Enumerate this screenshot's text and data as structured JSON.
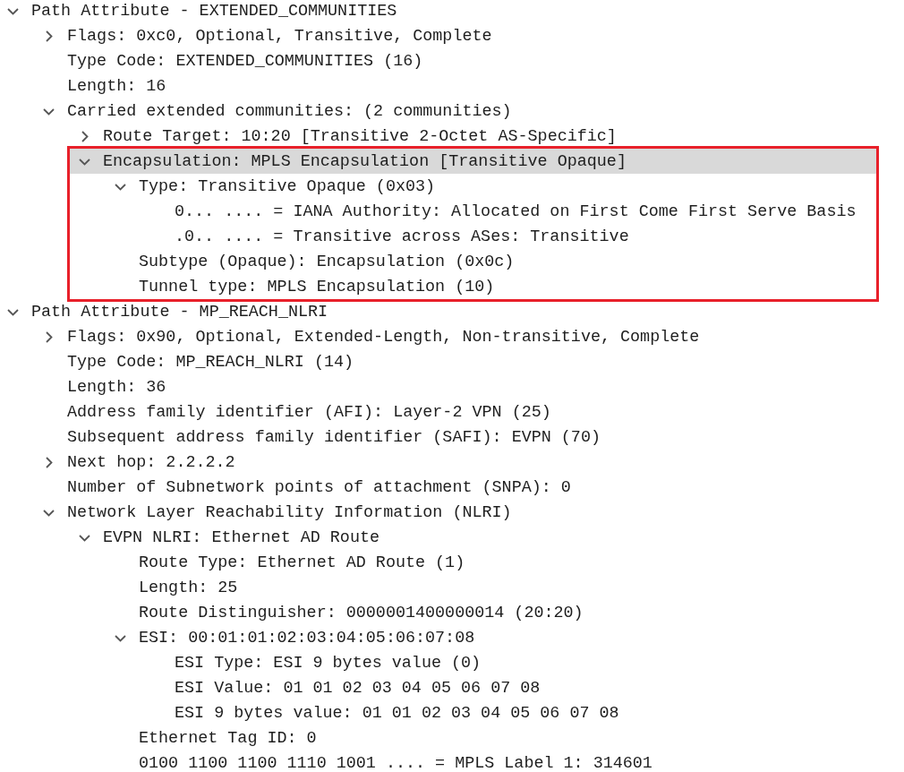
{
  "tree": [
    {
      "text": "Path Attribute - EXTENDED_COMMUNITIES",
      "expanded": true,
      "selected": false,
      "children": [
        {
          "text": "Flags: 0xc0, Optional, Transitive, Complete",
          "expanded": false,
          "selected": false
        },
        {
          "text": "Type Code: EXTENDED_COMMUNITIES (16)",
          "selected": false
        },
        {
          "text": "Length: 16",
          "selected": false
        },
        {
          "text": "Carried extended communities: (2 communities)",
          "expanded": true,
          "selected": false,
          "children": [
            {
              "text": "Route Target: 10:20 [Transitive 2-Octet AS-Specific]",
              "expanded": false,
              "selected": false
            },
            {
              "text": "Encapsulation: MPLS Encapsulation [Transitive Opaque]",
              "expanded": true,
              "selected": true,
              "outlined": true,
              "children": [
                {
                  "text": "Type: Transitive Opaque (0x03)",
                  "expanded": true,
                  "selected": false,
                  "children": [
                    {
                      "text": "0... .... = IANA Authority: Allocated on First Come First Serve Basis",
                      "selected": false
                    },
                    {
                      "text": ".0.. .... = Transitive across ASes: Transitive",
                      "selected": false
                    }
                  ]
                },
                {
                  "text": "Subtype (Opaque): Encapsulation (0x0c)",
                  "selected": false
                },
                {
                  "text": "Tunnel type: MPLS Encapsulation (10)",
                  "selected": false
                }
              ]
            }
          ]
        }
      ]
    },
    {
      "text": "Path Attribute - MP_REACH_NLRI",
      "expanded": true,
      "selected": false,
      "children": [
        {
          "text": "Flags: 0x90, Optional, Extended-Length, Non-transitive, Complete",
          "expanded": false,
          "selected": false
        },
        {
          "text": "Type Code: MP_REACH_NLRI (14)",
          "selected": false
        },
        {
          "text": "Length: 36",
          "selected": false
        },
        {
          "text": "Address family identifier (AFI): Layer-2 VPN (25)",
          "selected": false
        },
        {
          "text": "Subsequent address family identifier (SAFI): EVPN (70)",
          "selected": false
        },
        {
          "text": "Next hop: 2.2.2.2",
          "expanded": false,
          "selected": false
        },
        {
          "text": "Number of Subnetwork points of attachment (SNPA): 0",
          "selected": false
        },
        {
          "text": "Network Layer Reachability Information (NLRI)",
          "expanded": true,
          "selected": false,
          "children": [
            {
              "text": "EVPN NLRI: Ethernet AD Route",
              "expanded": true,
              "selected": false,
              "children": [
                {
                  "text": "Route Type: Ethernet AD Route (1)",
                  "selected": false
                },
                {
                  "text": "Length: 25",
                  "selected": false
                },
                {
                  "text": "Route Distinguisher: 0000001400000014 (20:20)",
                  "selected": false
                },
                {
                  "text": "ESI: 00:01:01:02:03:04:05:06:07:08",
                  "expanded": true,
                  "selected": false,
                  "children": [
                    {
                      "text": "ESI Type: ESI 9 bytes value (0)",
                      "selected": false
                    },
                    {
                      "text": "ESI Value: 01 01 02 03 04 05 06 07 08",
                      "selected": false
                    },
                    {
                      "text": "ESI 9 bytes value: 01 01 02 03 04 05 06 07 08",
                      "selected": false
                    }
                  ]
                },
                {
                  "text": "Ethernet Tag ID: 0",
                  "selected": false
                },
                {
                  "text": "0100 1100 1100 1110 1001 .... = MPLS Label 1: 314601",
                  "selected": false
                }
              ]
            }
          ]
        }
      ]
    }
  ]
}
